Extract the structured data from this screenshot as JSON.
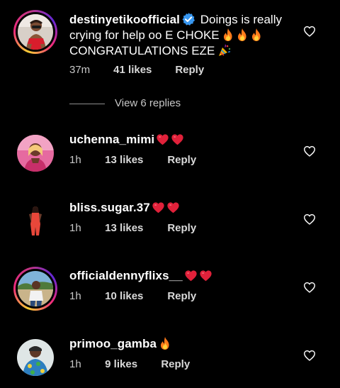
{
  "colors": {
    "background": "#000000",
    "text": "#ffffff",
    "meta": "#c7c7c7",
    "verified": "#3897f0",
    "heart_emoji": "#e0213a",
    "fire_emoji": "#ff9a1f"
  },
  "icons": {
    "like": "heart-outline-icon",
    "verified": "verified-badge-icon",
    "heart_emoji": "red-heart-emoji",
    "fire_emoji": "fire-emoji",
    "party_emoji": "party-popper-emoji"
  },
  "comments": [
    {
      "username": "destinyetikoofficial",
      "verified": true,
      "text_line1": "Doings is really",
      "text_line2": "crying for help oo E CHOKE",
      "text_line3": "CONGRATULATIONS EZE",
      "time": "37m",
      "likes": "41 likes",
      "reply": "Reply",
      "view_replies": "View 6 replies",
      "avatar_ring": true
    },
    {
      "username": "uchenna_mimi",
      "time": "1h",
      "likes": "13 likes",
      "reply": "Reply",
      "avatar_ring": false
    },
    {
      "username": "bliss.sugar.37",
      "time": "1h",
      "likes": "13 likes",
      "reply": "Reply",
      "avatar_ring": false
    },
    {
      "username": "officialdennyflixs__",
      "time": "1h",
      "likes": "10 likes",
      "reply": "Reply",
      "avatar_ring": true
    },
    {
      "username": "primoo_gamba",
      "time": "1h",
      "likes": "9 likes",
      "reply": "Reply",
      "avatar_ring": false
    }
  ]
}
